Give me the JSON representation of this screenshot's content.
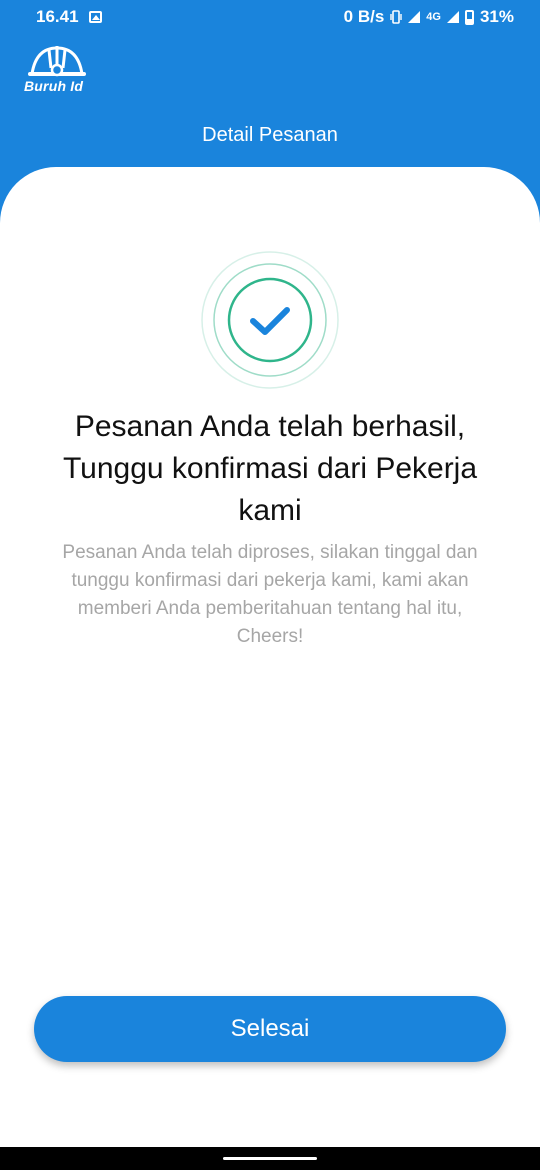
{
  "status_bar": {
    "time": "16.41",
    "net_speed": "0 B/s",
    "network_type": "4G",
    "battery": "31%",
    "icons": [
      "image-icon",
      "vibrate-icon",
      "signal-icon",
      "signal-icon",
      "battery-icon"
    ]
  },
  "app": {
    "logo_text": "Buruh Id",
    "title": "Detail Pesanan"
  },
  "success": {
    "icon": "check-icon",
    "headline": "Pesanan Anda telah berhasil,\nTunggu konfirmasi dari Pekerja\nkami",
    "description": "Pesanan Anda telah diproses, silakan tinggal dan\ntunggu konfirmasi dari pekerja kami, kami akan\nmemberi Anda pemberitahuan tentang hal itu,\nCheers!"
  },
  "actions": {
    "done_label": "Selesai"
  },
  "colors": {
    "primary": "#1a84dc",
    "success_ring": "#2fb58b",
    "check": "#1a84dc",
    "text_dark": "#111111",
    "text_muted": "#a6a6a6"
  }
}
